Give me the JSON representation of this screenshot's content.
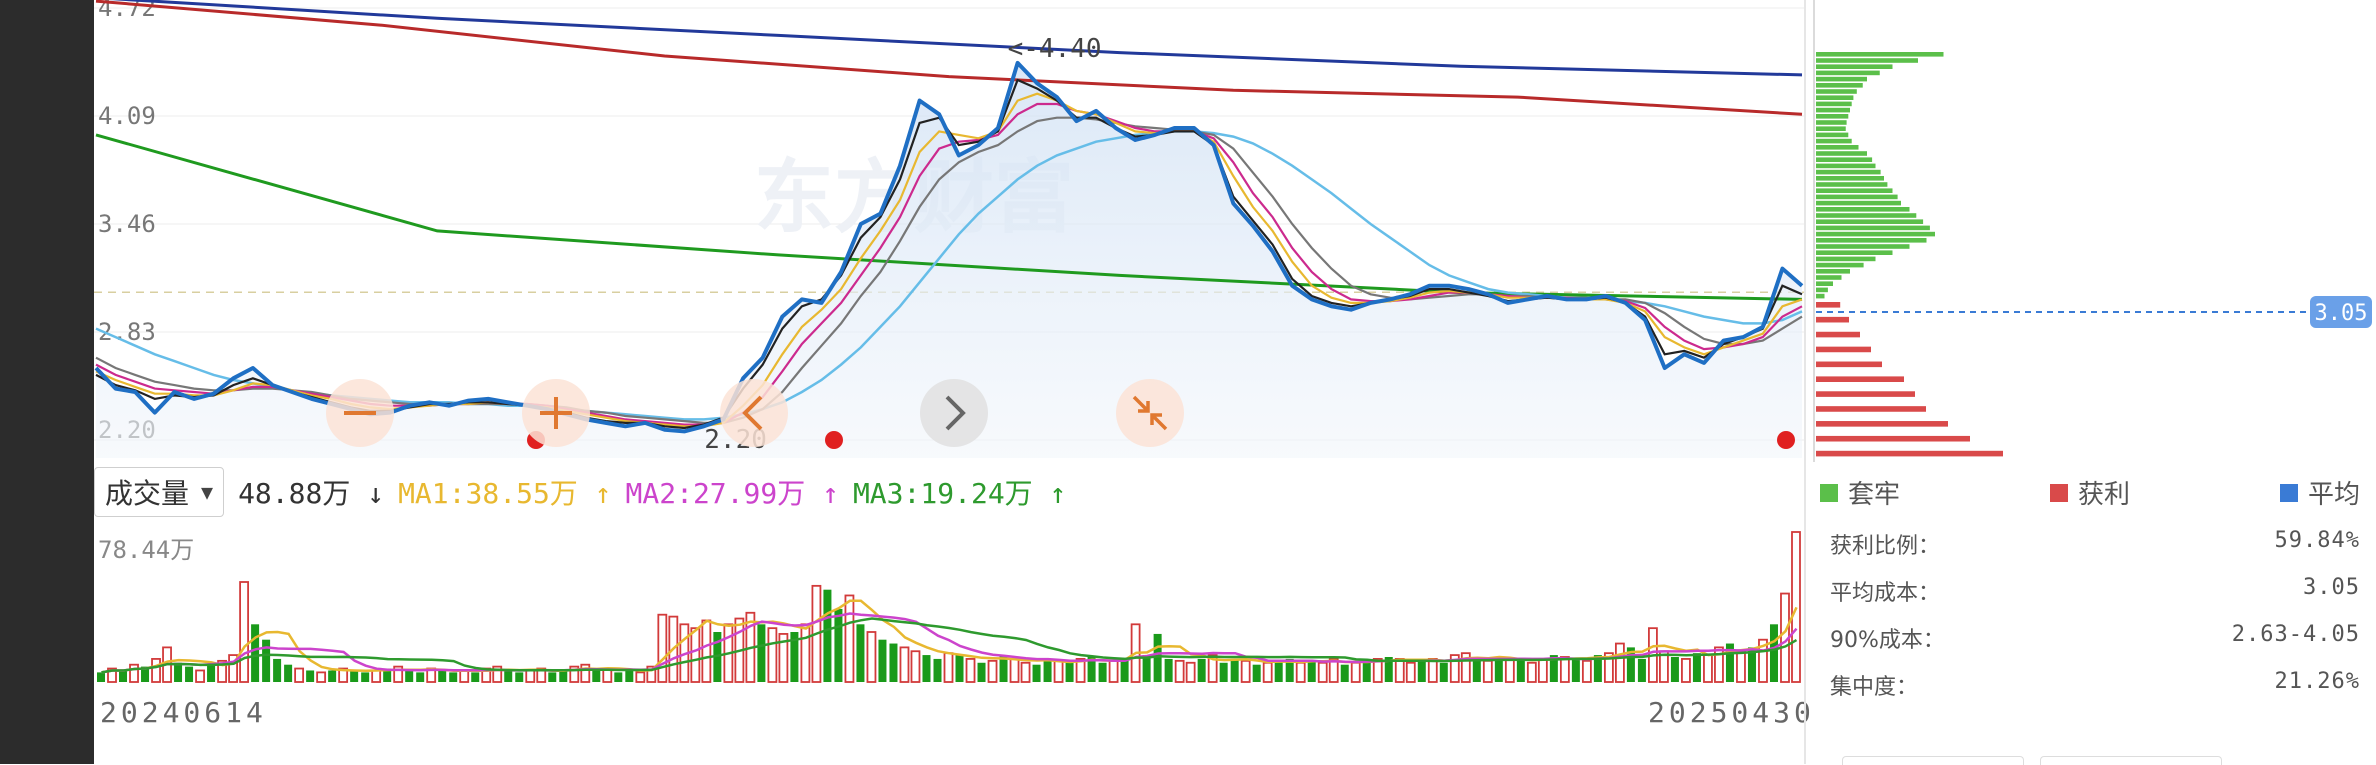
{
  "colors": {
    "price": "#1f6fc4",
    "ma_black": "#222222",
    "ma_yellow": "#e8b830",
    "ma_magenta": "#cc2a8e",
    "ma_gray": "#777777",
    "ma_lightblue": "#66bde8",
    "ma_green": "#1f9a1f",
    "ma_red": "#b82a2a",
    "ma_navy": "#22399a",
    "up": "#d23a3a",
    "down": "#1a9a1a",
    "avg_line": "#3a7bd5"
  },
  "chart_data": [
    {
      "type": "line",
      "y_ticks": [
        "4.72",
        "4.09",
        "3.46",
        "2.83",
        "2.20"
      ],
      "ylim": [
        2.2,
        4.72
      ],
      "annotations": {
        "high": "<-4.40",
        "low": "2.20",
        "current": "3.05"
      },
      "watermark": "东方财富",
      "nav_icons": [
        "minus-icon",
        "plus-icon",
        "chevron-left-icon",
        "chevron-right-icon",
        "compress-icon"
      ],
      "series": [
        {
          "key": "price",
          "values": [
            2.62,
            2.5,
            2.48,
            2.36,
            2.48,
            2.44,
            2.47,
            2.56,
            2.62,
            2.52,
            2.48,
            2.44,
            2.41,
            2.38,
            2.35,
            2.36,
            2.4,
            2.42,
            2.4,
            2.43,
            2.44,
            2.42,
            2.4,
            2.38,
            2.35,
            2.32,
            2.3,
            2.28,
            2.3,
            2.26,
            2.25,
            2.28,
            2.32,
            2.56,
            2.68,
            2.92,
            3.02,
            3.0,
            3.18,
            3.46,
            3.52,
            3.8,
            4.18,
            4.1,
            3.86,
            3.92,
            4.02,
            4.4,
            4.28,
            4.2,
            4.06,
            4.12,
            4.02,
            3.95,
            3.98,
            4.02,
            4.02,
            3.92,
            3.58,
            3.45,
            3.3,
            3.1,
            3.02,
            2.98,
            2.96,
            3.0,
            3.02,
            3.05,
            3.1,
            3.1,
            3.08,
            3.05,
            3.0,
            3.02,
            3.04,
            3.02,
            3.02,
            3.04,
            3.0,
            2.9,
            2.62,
            2.7,
            2.65,
            2.78,
            2.8,
            2.86,
            3.2,
            3.1
          ]
        },
        {
          "key": "ma_black",
          "values": [
            2.58,
            2.52,
            2.49,
            2.44,
            2.46,
            2.45,
            2.46,
            2.52,
            2.56,
            2.52,
            2.48,
            2.45,
            2.42,
            2.39,
            2.37,
            2.37,
            2.39,
            2.41,
            2.41,
            2.42,
            2.42,
            2.41,
            2.4,
            2.38,
            2.36,
            2.33,
            2.31,
            2.3,
            2.3,
            2.28,
            2.27,
            2.29,
            2.33,
            2.5,
            2.64,
            2.85,
            2.98,
            3.02,
            3.16,
            3.38,
            3.5,
            3.72,
            4.05,
            4.08,
            3.92,
            3.94,
            4.0,
            4.3,
            4.25,
            4.18,
            4.08,
            4.08,
            4.02,
            3.97,
            3.98,
            4.0,
            4.0,
            3.92,
            3.62,
            3.48,
            3.34,
            3.14,
            3.04,
            3.0,
            2.98,
            3.0,
            3.02,
            3.04,
            3.08,
            3.08,
            3.06,
            3.04,
            3.01,
            3.02,
            3.03,
            3.02,
            3.02,
            3.03,
            3.0,
            2.92,
            2.7,
            2.72,
            2.68,
            2.76,
            2.8,
            2.85,
            3.1,
            3.05
          ]
        },
        {
          "key": "ma_yellow",
          "values": [
            2.6,
            2.55,
            2.51,
            2.47,
            2.47,
            2.46,
            2.46,
            2.49,
            2.53,
            2.52,
            2.49,
            2.46,
            2.44,
            2.41,
            2.39,
            2.38,
            2.39,
            2.4,
            2.41,
            2.41,
            2.42,
            2.41,
            2.4,
            2.39,
            2.37,
            2.35,
            2.33,
            2.31,
            2.3,
            2.29,
            2.28,
            2.28,
            2.3,
            2.4,
            2.52,
            2.7,
            2.86,
            2.96,
            3.08,
            3.26,
            3.42,
            3.6,
            3.88,
            4.0,
            3.98,
            3.96,
            4.0,
            4.18,
            4.22,
            4.18,
            4.12,
            4.1,
            4.05,
            4.0,
            3.99,
            4.0,
            4.0,
            3.94,
            3.74,
            3.56,
            3.42,
            3.24,
            3.1,
            3.03,
            3.0,
            3.0,
            3.01,
            3.03,
            3.06,
            3.07,
            3.06,
            3.05,
            3.03,
            3.03,
            3.03,
            3.02,
            3.02,
            3.02,
            3.0,
            2.95,
            2.8,
            2.74,
            2.7,
            2.74,
            2.78,
            2.82,
            2.98,
            3.02
          ]
        },
        {
          "key": "ma_magenta",
          "values": [
            2.64,
            2.58,
            2.54,
            2.5,
            2.49,
            2.48,
            2.47,
            2.49,
            2.51,
            2.51,
            2.49,
            2.47,
            2.45,
            2.43,
            2.41,
            2.4,
            2.4,
            2.4,
            2.41,
            2.41,
            2.42,
            2.41,
            2.41,
            2.4,
            2.38,
            2.36,
            2.34,
            2.32,
            2.31,
            2.3,
            2.29,
            2.29,
            2.3,
            2.36,
            2.45,
            2.6,
            2.76,
            2.88,
            3.0,
            3.16,
            3.32,
            3.5,
            3.74,
            3.9,
            3.94,
            3.95,
            3.98,
            4.1,
            4.16,
            4.16,
            4.12,
            4.1,
            4.06,
            4.02,
            4.0,
            4.0,
            4.0,
            3.96,
            3.82,
            3.64,
            3.5,
            3.32,
            3.18,
            3.08,
            3.02,
            3.01,
            3.01,
            3.02,
            3.04,
            3.06,
            3.06,
            3.05,
            3.04,
            3.03,
            3.03,
            3.03,
            3.02,
            3.02,
            3.01,
            2.97,
            2.86,
            2.78,
            2.73,
            2.74,
            2.76,
            2.8,
            2.92,
            2.98
          ]
        },
        {
          "key": "ma_gray",
          "values": [
            2.68,
            2.62,
            2.58,
            2.54,
            2.52,
            2.5,
            2.49,
            2.49,
            2.5,
            2.5,
            2.49,
            2.48,
            2.46,
            2.44,
            2.43,
            2.42,
            2.41,
            2.41,
            2.41,
            2.41,
            2.41,
            2.41,
            2.41,
            2.4,
            2.39,
            2.37,
            2.36,
            2.34,
            2.33,
            2.32,
            2.31,
            2.3,
            2.3,
            2.33,
            2.38,
            2.48,
            2.62,
            2.75,
            2.88,
            3.04,
            3.18,
            3.36,
            3.56,
            3.72,
            3.82,
            3.88,
            3.92,
            4.0,
            4.06,
            4.08,
            4.08,
            4.07,
            4.05,
            4.03,
            4.02,
            4.01,
            4.0,
            3.98,
            3.9,
            3.76,
            3.62,
            3.46,
            3.32,
            3.2,
            3.1,
            3.05,
            3.03,
            3.02,
            3.03,
            3.04,
            3.05,
            3.05,
            3.04,
            3.04,
            3.03,
            3.03,
            3.03,
            3.02,
            3.02,
            3.0,
            2.94,
            2.86,
            2.79,
            2.76,
            2.76,
            2.78,
            2.85,
            2.92
          ]
        },
        {
          "key": "ma_lightblue",
          "values": [
            2.85,
            2.8,
            2.75,
            2.7,
            2.66,
            2.62,
            2.58,
            2.55,
            2.53,
            2.51,
            2.49,
            2.47,
            2.46,
            2.45,
            2.44,
            2.43,
            2.42,
            2.42,
            2.42,
            2.41,
            2.41,
            2.4,
            2.4,
            2.39,
            2.38,
            2.37,
            2.36,
            2.35,
            2.34,
            2.33,
            2.32,
            2.32,
            2.33,
            2.35,
            2.38,
            2.42,
            2.48,
            2.55,
            2.64,
            2.74,
            2.86,
            2.98,
            3.12,
            3.26,
            3.4,
            3.52,
            3.62,
            3.72,
            3.8,
            3.86,
            3.9,
            3.94,
            3.96,
            3.98,
            3.99,
            4.0,
            4.0,
            3.99,
            3.97,
            3.93,
            3.87,
            3.8,
            3.72,
            3.64,
            3.55,
            3.46,
            3.38,
            3.3,
            3.22,
            3.16,
            3.12,
            3.08,
            3.06,
            3.05,
            3.04,
            3.03,
            3.03,
            3.02,
            3.01,
            3.0,
            2.98,
            2.95,
            2.92,
            2.9,
            2.88,
            2.88,
            2.9,
            2.95
          ]
        },
        {
          "key": "ma_green",
          "values": [
            3.98,
            3.42,
            3.28,
            3.16,
            3.06,
            3.02
          ]
        },
        {
          "key": "ma_red",
          "values": [
            4.76,
            4.62,
            4.44,
            4.32,
            4.24,
            4.2,
            4.1
          ]
        },
        {
          "key": "ma_navy",
          "values": [
            4.78,
            4.66,
            4.56,
            4.46,
            4.38,
            4.33
          ]
        }
      ]
    },
    {
      "type": "bar",
      "max_label": "78.44万",
      "x_start_label": "20240614",
      "x_end_label": "20250430",
      "current_volume": "48.88万",
      "ma1": "MA1:38.55万",
      "ma2": "MA2:27.99万",
      "ma3": "MA3:19.24万",
      "values": [
        5,
        7,
        6,
        9,
        8,
        12,
        18,
        10,
        8,
        6,
        9,
        11,
        14,
        52,
        30,
        22,
        12,
        9,
        7,
        6,
        5,
        6,
        7,
        6,
        5,
        6,
        7,
        8,
        6,
        5,
        7,
        6,
        5,
        6,
        5,
        7,
        8,
        6,
        5,
        6,
        7,
        5,
        6,
        8,
        9,
        6,
        7,
        5,
        6,
        5,
        8,
        35,
        34,
        30,
        28,
        32,
        26,
        30,
        33,
        36,
        30,
        28,
        25,
        26,
        30,
        50,
        48,
        38,
        45,
        30,
        26,
        22,
        20,
        18,
        16,
        14,
        12,
        15,
        14,
        12,
        10,
        11,
        14,
        12,
        10,
        9,
        12,
        11,
        10,
        12,
        13,
        10,
        11,
        12,
        30,
        14,
        25,
        12,
        11,
        10,
        12,
        14,
        10,
        12,
        11,
        9,
        10,
        11,
        12,
        10,
        11,
        10,
        12,
        9,
        10,
        11,
        12,
        13,
        12,
        10,
        11,
        12,
        10,
        14,
        15,
        12,
        11,
        13,
        12,
        11,
        10,
        12,
        14,
        13,
        12,
        11,
        14,
        15,
        20,
        18,
        12,
        28,
        16,
        13,
        12,
        15,
        14,
        18,
        20,
        16,
        18,
        22,
        30,
        46,
        78
      ],
      "up": [
        0,
        1,
        0,
        1,
        0,
        1,
        1,
        0,
        0,
        1,
        0,
        1,
        1,
        1,
        0,
        0,
        0,
        0,
        1,
        0,
        1,
        0,
        1,
        0,
        0,
        1,
        0,
        1,
        0,
        0,
        1,
        0,
        0,
        1,
        0,
        1,
        1,
        0,
        0,
        1,
        1,
        0,
        0,
        1,
        1,
        0,
        1,
        0,
        0,
        1,
        1,
        1,
        1,
        1,
        1,
        1,
        0,
        1,
        1,
        1,
        0,
        1,
        1,
        0,
        1,
        1,
        0,
        0,
        1,
        0,
        1,
        0,
        0,
        1,
        1,
        0,
        0,
        1,
        0,
        1,
        0,
        1,
        0,
        1,
        1,
        0,
        0,
        1,
        0,
        1,
        0,
        0,
        1,
        0,
        1,
        0,
        0,
        0,
        1,
        1,
        0,
        1,
        0,
        0,
        1,
        0,
        1,
        0,
        0,
        1,
        0,
        1,
        1,
        0,
        1,
        0,
        1,
        0,
        1,
        1,
        0,
        1,
        0,
        1,
        1,
        0,
        1,
        0,
        1,
        0,
        1,
        1,
        0,
        1,
        0,
        1,
        0,
        1,
        1,
        0,
        0,
        1,
        1,
        0,
        1,
        0,
        1,
        1,
        0,
        1,
        0,
        1,
        0,
        1,
        1,
        0
      ]
    },
    {
      "type": "bar",
      "orientation": "horizontal",
      "name": "chip-distribution",
      "profit": [
        20,
        60,
        95,
        110,
        150,
        180,
        210,
        260,
        300,
        340,
        320,
        280,
        200,
        170,
        140,
        120,
        100,
        90,
        80,
        60,
        50,
        40,
        30,
        22
      ],
      "trapped": [
        150,
        120,
        90,
        75,
        60,
        55,
        48,
        44,
        42,
        40,
        38,
        36,
        35,
        38,
        42,
        50,
        60,
        66,
        70,
        76,
        80,
        84,
        90,
        96,
        100,
        110,
        118,
        126,
        134,
        140,
        130,
        110,
        90,
        70,
        56,
        40,
        30,
        20,
        14,
        10
      ]
    }
  ],
  "chip_legend": {
    "trapped": "套牢",
    "profit": "获利",
    "average": "平均"
  },
  "chip_stats": [
    {
      "label": "获利比例：",
      "value": "59.84%"
    },
    {
      "label": "平均成本：",
      "value": "3.05"
    },
    {
      "label": "90%成本：",
      "value": "2.63-4.05"
    },
    {
      "label": "集中度：",
      "value": "21.26%"
    }
  ],
  "vol_legend": {
    "selector": "成交量",
    "arrow_down": "↓",
    "arrow_up": "↑"
  }
}
